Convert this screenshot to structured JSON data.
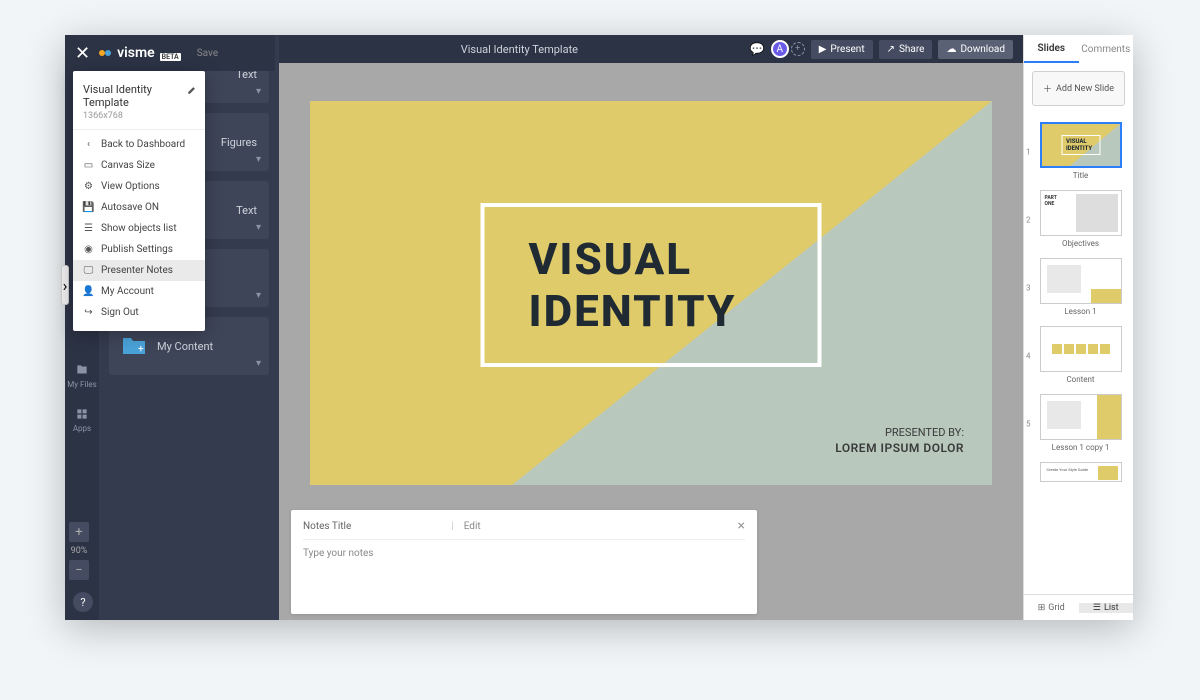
{
  "app": {
    "name": "visme",
    "beta_badge": "BETA",
    "save_label": "Save"
  },
  "project": {
    "title": "Visual Identity Template",
    "dimensions": "1366x768"
  },
  "menu": {
    "items": [
      {
        "label": "Back to Dashboard",
        "icon": "chevron-left"
      },
      {
        "label": "Canvas Size",
        "icon": "canvas"
      },
      {
        "label": "View Options",
        "icon": "gear"
      },
      {
        "label": "Autosave ON",
        "icon": "floppy"
      },
      {
        "label": "Show objects list",
        "icon": "list"
      },
      {
        "label": "Publish Settings",
        "icon": "publish"
      },
      {
        "label": "Presenter Notes",
        "icon": "presenter",
        "highlighted": true
      },
      {
        "label": "My Account",
        "icon": "user"
      },
      {
        "label": "Sign Out",
        "icon": "signout"
      }
    ]
  },
  "left_sidebar": {
    "items": [
      {
        "label": "My Files",
        "icon": "files"
      },
      {
        "label": "Apps",
        "icon": "apps"
      }
    ]
  },
  "tools": {
    "items": [
      {
        "label": "Text"
      },
      {
        "label": "Figures"
      },
      {
        "label": "Text"
      },
      {
        "label": ""
      },
      {
        "label": "My Content"
      }
    ]
  },
  "topbar": {
    "title": "Visual Identity Template",
    "avatar_letter": "A",
    "present": "Present",
    "share": "Share",
    "download": "Download"
  },
  "slide": {
    "title": "VISUAL IDENTITY",
    "presented_by_label": "PRESENTED BY:",
    "presented_by_value": "LOREM IPSUM DOLOR"
  },
  "notes": {
    "title_label": "Notes Title",
    "title_value": "",
    "edit_label": "Edit",
    "body_placeholder": "Type your notes"
  },
  "right_panel": {
    "tabs": {
      "slides": "Slides",
      "comments": "Comments"
    },
    "add_slide": "Add New Slide",
    "thumbs": [
      {
        "num": "1",
        "label": "Title"
      },
      {
        "num": "2",
        "label": "Objectives"
      },
      {
        "num": "3",
        "label": "Lesson 1"
      },
      {
        "num": "4",
        "label": "Content"
      },
      {
        "num": "5",
        "label": "Lesson 1 copy 1"
      }
    ],
    "grid": "Grid",
    "list": "List"
  },
  "zoom": {
    "plus": "+",
    "value": "90%",
    "minus": "−"
  },
  "help": "?"
}
